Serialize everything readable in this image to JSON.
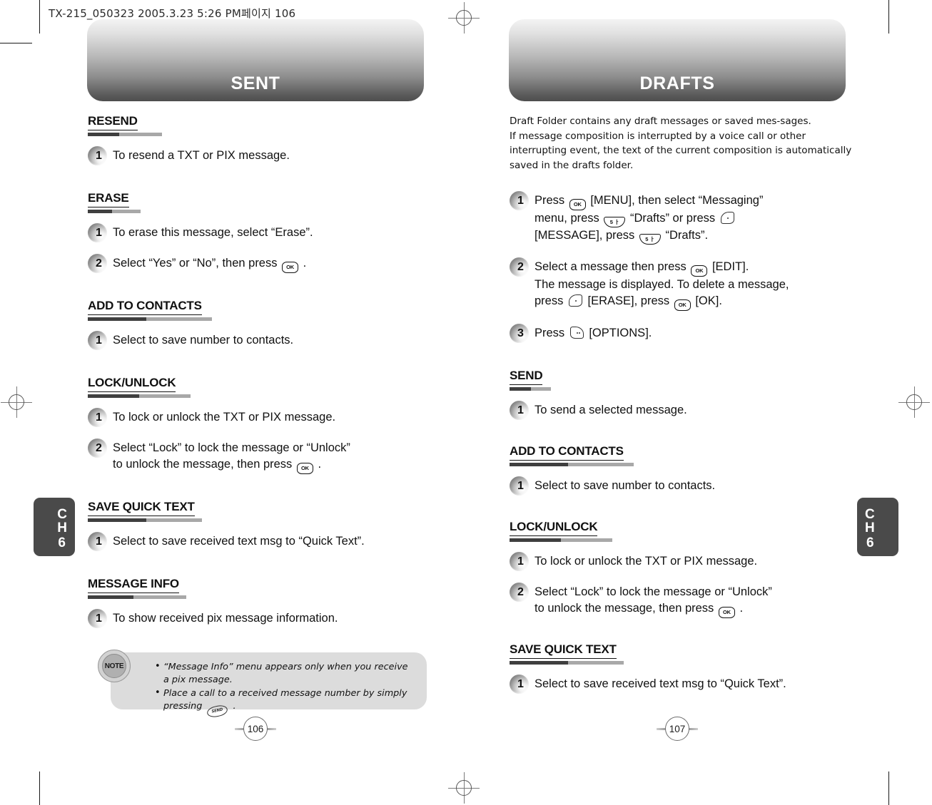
{
  "document": {
    "file_stamp": "TX-215_050323  2005.3.23 5:26 PM페이지 106",
    "chapter_tab": {
      "line1": "C",
      "line2": "H",
      "number": "6"
    }
  },
  "left_page": {
    "banner_title": "SENT",
    "page_number": "106",
    "sections": [
      {
        "title": "RESEND",
        "steps": [
          {
            "num": "1",
            "lines": [
              "To resend a TXT or PIX message."
            ]
          }
        ]
      },
      {
        "title": "ERASE",
        "steps": [
          {
            "num": "1",
            "lines": [
              "To erase this message, select “Erase”."
            ]
          },
          {
            "num": "2",
            "lines": [
              "Select “Yes” or “No”, then press [OK-KEY] ."
            ]
          }
        ]
      },
      {
        "title": "ADD TO CONTACTS",
        "steps": [
          {
            "num": "1",
            "lines": [
              "Select to save number to contacts."
            ]
          }
        ]
      },
      {
        "title": "LOCK/UNLOCK",
        "steps": [
          {
            "num": "1",
            "lines": [
              "To lock or unlock the TXT or PIX message."
            ]
          },
          {
            "num": "2",
            "lines": [
              "Select “Lock” to lock the message or “Unlock”",
              "to unlock the message, then press [OK-KEY] ."
            ]
          }
        ]
      },
      {
        "title": "SAVE QUICK TEXT",
        "steps": [
          {
            "num": "1",
            "lines": [
              "Select to save received text msg to “Quick Text”."
            ]
          }
        ]
      },
      {
        "title": "MESSAGE INFO",
        "steps": [
          {
            "num": "1",
            "lines": [
              "To show received pix message information."
            ]
          }
        ]
      }
    ],
    "note": {
      "icon_label": "NOTE",
      "items": [
        "“Message Info” menu appears only when you receive a pix message.",
        "Place a call to a received message number by simply pressing [SEND-KEY] ."
      ]
    }
  },
  "right_page": {
    "banner_title": "DRAFTS",
    "page_number": "107",
    "intro": [
      "Draft Folder contains any draft messages or saved mes-sages.",
      "If message composition is interrupted by a voice call or other",
      "interrupting event, the text of the current composition is automatically",
      "saved in the drafts folder."
    ],
    "intro_steps": [
      {
        "num": "1",
        "lines": [
          "Press [OK-KEY] [MENU], then select “Messaging”",
          "menu, press [5-KEY] “Drafts” or press [SOFT-L]",
          "[MESSAGE], press [5-KEY] “Drafts”."
        ]
      },
      {
        "num": "2",
        "lines": [
          "Select a message then press [OK-KEY] [EDIT].",
          "The message is displayed. To delete a message,",
          "press [SOFT-L] [ERASE], press [OK-KEY] [OK]."
        ]
      },
      {
        "num": "3",
        "lines": [
          "Press [SOFT-R] [OPTIONS]."
        ]
      }
    ],
    "sections": [
      {
        "title": "SEND",
        "steps": [
          {
            "num": "1",
            "lines": [
              "To send a selected message."
            ]
          }
        ]
      },
      {
        "title": "ADD TO CONTACTS",
        "steps": [
          {
            "num": "1",
            "lines": [
              "Select to save number to contacts."
            ]
          }
        ]
      },
      {
        "title": "LOCK/UNLOCK",
        "steps": [
          {
            "num": "1",
            "lines": [
              "To lock or unlock the TXT or PIX message."
            ]
          },
          {
            "num": "2",
            "lines": [
              "Select “Lock” to lock the message or “Unlock”",
              "to unlock the message, then press [OK-KEY] ."
            ]
          }
        ]
      },
      {
        "title": "SAVE QUICK TEXT",
        "steps": [
          {
            "num": "1",
            "lines": [
              "Select to save received text msg to “Quick Text”."
            ]
          }
        ]
      }
    ]
  },
  "keys": {
    "ok": "OK",
    "five": "5",
    "send": "SEND"
  },
  "colors": {
    "tab_bg": "#4a4a4a",
    "note_bg": "#dcdcdc",
    "rule_dark": "#3f3f3f",
    "rule_light": "#a8a8a8"
  }
}
